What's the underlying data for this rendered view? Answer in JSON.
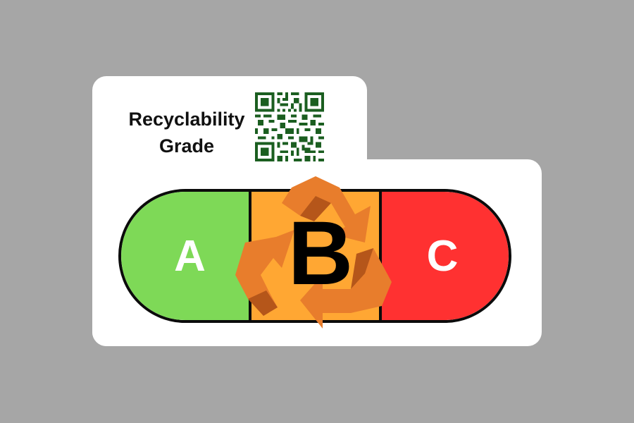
{
  "label": {
    "title_line1": "Recyclability",
    "title_line2": "Grade",
    "grades": [
      "A",
      "B",
      "C"
    ],
    "selected_grade": "B",
    "colors": {
      "background": "#a6a6a6",
      "card": "#ffffff",
      "grade_a": "#7ed957",
      "grade_b": "#ffa733",
      "grade_c": "#ff3131",
      "recycle_symbol": "#e87d2c",
      "qr": "#1b5e20"
    },
    "icons": {
      "qr": "qr-code-icon",
      "recycle": "recycle-icon"
    }
  }
}
